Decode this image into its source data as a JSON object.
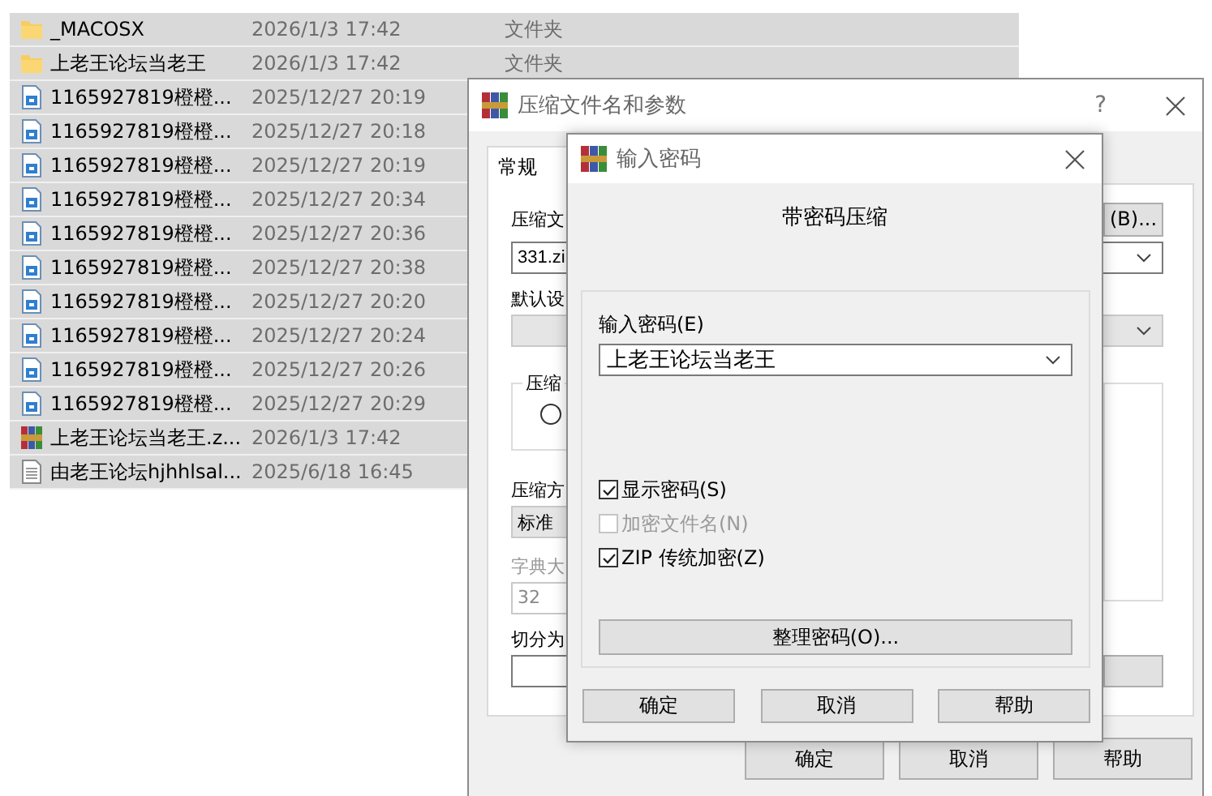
{
  "file_list": [
    {
      "kind": "folder",
      "name": "_MACOSX",
      "date": "2026/1/3 17:42",
      "type": "文件夹",
      "selected": true
    },
    {
      "kind": "folder",
      "name": "上老王论坛当老王",
      "date": "2026/1/3 17:42",
      "type": "文件夹",
      "selected": true
    },
    {
      "kind": "image",
      "name": "1165927819橙橙...",
      "date": "2025/12/27 20:19",
      "selected": true
    },
    {
      "kind": "image",
      "name": "1165927819橙橙...",
      "date": "2025/12/27 20:18",
      "selected": true
    },
    {
      "kind": "image",
      "name": "1165927819橙橙...",
      "date": "2025/12/27 20:19",
      "selected": true
    },
    {
      "kind": "image",
      "name": "1165927819橙橙...",
      "date": "2025/12/27 20:34",
      "selected": true
    },
    {
      "kind": "image",
      "name": "1165927819橙橙...",
      "date": "2025/12/27 20:36",
      "selected": true
    },
    {
      "kind": "image",
      "name": "1165927819橙橙...",
      "date": "2025/12/27 20:38",
      "selected": true
    },
    {
      "kind": "image",
      "name": "1165927819橙橙...",
      "date": "2025/12/27 20:20",
      "selected": true
    },
    {
      "kind": "image",
      "name": "1165927819橙橙...",
      "date": "2025/12/27 20:24",
      "selected": true
    },
    {
      "kind": "image",
      "name": "1165927819橙橙...",
      "date": "2025/12/27 20:26",
      "selected": true
    },
    {
      "kind": "image",
      "name": "1165927819橙橙...",
      "date": "2025/12/27 20:29",
      "selected": true
    },
    {
      "kind": "archive",
      "name": "上老王论坛当老王.z...",
      "date": "2026/1/3 17:42",
      "selected": true
    },
    {
      "kind": "text",
      "name": "由老王论坛hjhhlsal...",
      "date": "2025/6/18 16:45",
      "selected": true
    }
  ],
  "archive_dialog": {
    "title": "压缩文件名和参数",
    "help": "?",
    "tabs": [
      {
        "label": "常规",
        "selected": true
      }
    ],
    "archive_name_label": "压缩文",
    "browse_button": "(B)...",
    "archive_name_value": "331.zi",
    "profile_label": "默认设",
    "format_group_label": "压缩",
    "format_options": [
      {
        "selected": false
      }
    ],
    "method_label": "压缩方",
    "method_value": "标准",
    "dictionary_label": "字典大",
    "dictionary_value": "32",
    "split_label": "切分为",
    "buttons": [
      "确定",
      "取消",
      "帮助"
    ]
  },
  "password_dialog": {
    "title": "输入密码",
    "heading": "带密码压缩",
    "password_label": "输入密码(E)",
    "password_value": "上老王论坛当老王",
    "options": [
      {
        "label": "显示密码(S)",
        "checked": true,
        "disabled": false
      },
      {
        "label": "加密文件名(N)",
        "checked": false,
        "disabled": true
      },
      {
        "label": "ZIP 传统加密(Z)",
        "checked": true,
        "disabled": false
      }
    ],
    "organize_button": "整理密码(O)...",
    "buttons": [
      "确定",
      "取消",
      "帮助"
    ]
  }
}
